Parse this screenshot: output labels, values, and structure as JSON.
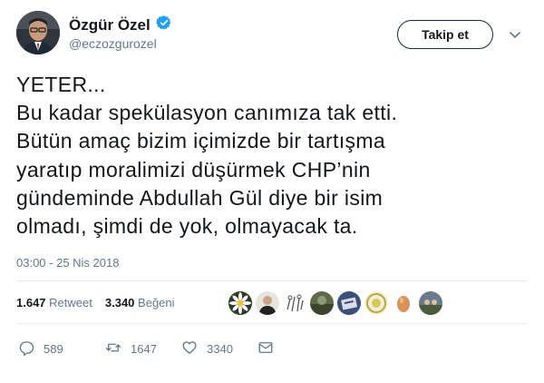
{
  "user": {
    "display_name": "Özgür Özel",
    "handle": "@eczozgurozel",
    "verified": true
  },
  "follow_button": {
    "label": "Takip et"
  },
  "tweet": {
    "lines": [
      "YETER...",
      "Bu kadar spekülasyon canımıza tak etti.",
      "Bütün amaç bizim içimizde bir tartışma",
      "yaratıp moralimizi düşürmek CHP’nin",
      "gündeminde Abdullah Gül diye bir isim",
      "olmadı, şimdi de yok, olmayacak ta."
    ],
    "timestamp": "03:00 - 25 Nis 2018"
  },
  "stats": {
    "retweets_count": "1.647",
    "retweets_label": "Retweet",
    "likes_count": "3.340",
    "likes_label": "Beğeni"
  },
  "actions": {
    "reply_count": "589",
    "retweet_count": "1647",
    "like_count": "3340"
  },
  "icons": {
    "verified": "verified-badge-icon",
    "caret": "chevron-down-icon",
    "reply": "reply-icon",
    "retweet": "retweet-icon",
    "like": "heart-icon",
    "dm": "envelope-icon"
  },
  "colors": {
    "text": "#14171a",
    "muted": "#657786",
    "verified_blue": "#1da1f2",
    "divider": "#e6ecf0"
  }
}
